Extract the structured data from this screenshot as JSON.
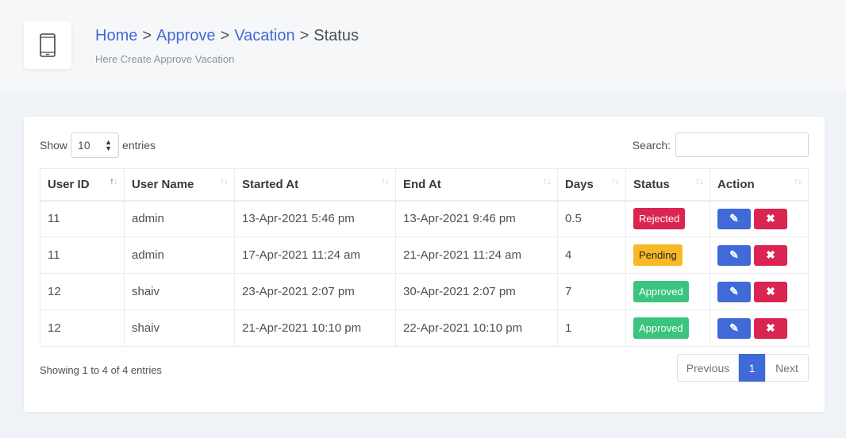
{
  "breadcrumb": {
    "home": "Home",
    "approve": "Approve",
    "vacation": "Vacation",
    "current": "Status",
    "separator": ">"
  },
  "subtitle": "Here Create Approve Vacation",
  "length": {
    "show_label": "Show",
    "value": "10",
    "entries_label": "entries"
  },
  "search": {
    "label": "Search:",
    "value": ""
  },
  "table": {
    "headers": [
      "User ID",
      "User Name",
      "Started At",
      "End At",
      "Days",
      "Status",
      "Action"
    ],
    "rows": [
      {
        "user_id": "11",
        "user_name": "admin",
        "started_at": "13-Apr-2021 5:46 pm",
        "end_at": "13-Apr-2021 9:46 pm",
        "days": "0.5",
        "status": "Rejected"
      },
      {
        "user_id": "11",
        "user_name": "admin",
        "started_at": "17-Apr-2021 11:24 am",
        "end_at": "21-Apr-2021 11:24 am",
        "days": "4",
        "status": "Pending"
      },
      {
        "user_id": "12",
        "user_name": "shaiv",
        "started_at": "23-Apr-2021 2:07 pm",
        "end_at": "30-Apr-2021 2:07 pm",
        "days": "7",
        "status": "Approved"
      },
      {
        "user_id": "12",
        "user_name": "shaiv",
        "started_at": "21-Apr-2021 10:10 pm",
        "end_at": "22-Apr-2021 10:10 pm",
        "days": "1",
        "status": "Approved"
      }
    ]
  },
  "info": "Showing 1 to 4 of 4 entries",
  "pagination": {
    "previous": "Previous",
    "current": "1",
    "next": "Next"
  },
  "icons": {
    "header": "tablet-icon",
    "edit": "edit-icon",
    "delete": "close-icon"
  },
  "colors": {
    "primary": "#3f6ad8",
    "danger": "#d92550",
    "warning": "#f7b924",
    "success": "#3ac47d"
  }
}
